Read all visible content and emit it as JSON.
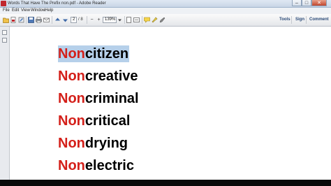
{
  "window": {
    "title": "Words That Have The Prefix non.pdf - Adobe Reader",
    "minimize": "–",
    "maximize": "□",
    "close": "✕"
  },
  "menu": [
    "File",
    "Edit",
    "View",
    "Window",
    "Help"
  ],
  "toolbar": {
    "page_current": "2",
    "page_total": "/ 8",
    "zoom_out": "−",
    "zoom_in": "+",
    "zoom_value": "139%",
    "tools": "Tools",
    "sign": "Sign",
    "comment": "Comment"
  },
  "document": {
    "prefix": "Non",
    "words": [
      {
        "prefix": "Non",
        "rest": "citizen"
      },
      {
        "prefix": "Non",
        "rest": "creative"
      },
      {
        "prefix": "Non",
        "rest": "criminal"
      },
      {
        "prefix": "Non",
        "rest": "critical"
      },
      {
        "prefix": "Non",
        "rest": "drying"
      },
      {
        "prefix": "Non",
        "rest": "electric"
      }
    ]
  },
  "colors": {
    "prefix": "#d4201a",
    "selection": "#b6d0ea"
  }
}
